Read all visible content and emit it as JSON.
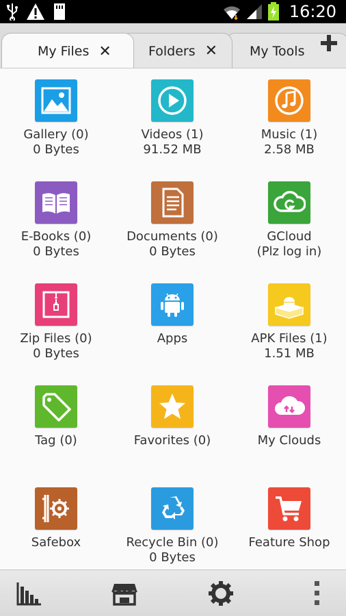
{
  "status_bar": {
    "time": "16:20",
    "icons": [
      "usb-icon",
      "warning-icon",
      "sd-card-icon",
      "wifi-icon",
      "signal-icon",
      "battery-charging-icon"
    ]
  },
  "tabs": [
    {
      "label": "My Files",
      "active": true
    },
    {
      "label": "Folders",
      "active": false
    },
    {
      "label": "My Tools",
      "active": false
    }
  ],
  "items": [
    {
      "key": "gallery",
      "name": "Gallery (0)",
      "sub": "0 Bytes",
      "color": "#1a9ee6",
      "icon": "gallery-icon"
    },
    {
      "key": "videos",
      "name": "Videos (1)",
      "sub": "91.52 MB",
      "color": "#22b8c9",
      "icon": "video-play-icon"
    },
    {
      "key": "music",
      "name": "Music (1)",
      "sub": "2.58 MB",
      "color": "#f28a1e",
      "icon": "music-note-icon"
    },
    {
      "key": "ebooks",
      "name": "E-Books (0)",
      "sub": "0 Bytes",
      "color": "#8c5bc2",
      "icon": "book-icon"
    },
    {
      "key": "documents",
      "name": "Documents (0)",
      "sub": "0 Bytes",
      "color": "#c0703c",
      "icon": "document-icon"
    },
    {
      "key": "gcloud",
      "name": "GCloud",
      "sub": "(Plz log in)",
      "color": "#3aa53a",
      "icon": "gcloud-icon"
    },
    {
      "key": "zip",
      "name": "Zip Files (0)",
      "sub": "0 Bytes",
      "color": "#e83f79",
      "icon": "zip-icon"
    },
    {
      "key": "apps",
      "name": "Apps",
      "sub": "",
      "color": "#2aa0e8",
      "icon": "android-icon"
    },
    {
      "key": "apk",
      "name": "APK Files (1)",
      "sub": "1.51 MB",
      "color": "#f5c91e",
      "icon": "apk-box-icon"
    },
    {
      "key": "tag",
      "name": "Tag (0)",
      "sub": "",
      "color": "#5fb82c",
      "icon": "tag-icon"
    },
    {
      "key": "favorites",
      "name": "Favorites (0)",
      "sub": "",
      "color": "#f5b51a",
      "icon": "star-icon"
    },
    {
      "key": "myclouds",
      "name": "My Clouds",
      "sub": "",
      "color": "#e54fb0",
      "icon": "cloud-sync-icon"
    },
    {
      "key": "safebox",
      "name": "Safebox",
      "sub": "",
      "color": "#b8612a",
      "icon": "safe-icon"
    },
    {
      "key": "recycle",
      "name": "Recycle Bin (0)",
      "sub": "0 Bytes",
      "color": "#2b9be0",
      "icon": "recycle-icon"
    },
    {
      "key": "featureshop",
      "name": "Feature Shop",
      "sub": "",
      "color": "#ee4a38",
      "icon": "shopping-cart-icon"
    }
  ],
  "bottom_bar": [
    "storage-analysis-icon",
    "store-icon",
    "settings-gear-icon",
    "overflow-menu-icon"
  ]
}
